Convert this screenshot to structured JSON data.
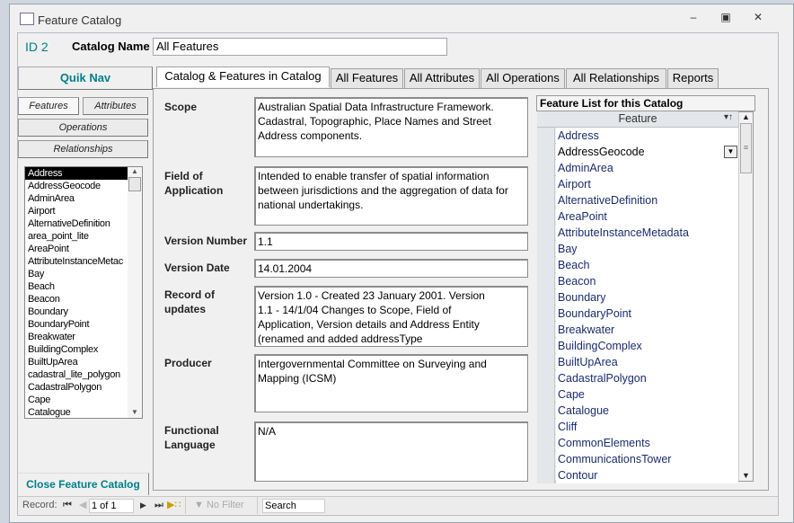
{
  "window": {
    "title": "Feature Catalog",
    "controls": [
      "minimize",
      "restore",
      "close"
    ]
  },
  "header": {
    "id_label": "ID",
    "id_value": "2",
    "catalog_name_label": "Catalog Name",
    "catalog_name_value": "All Features"
  },
  "quik_nav": {
    "label": "Quik Nav",
    "buttons": [
      "Features",
      "Attributes",
      "Operations",
      "Relationships"
    ]
  },
  "left_list": {
    "items": [
      "Address",
      "AddressGeocode",
      "AdminArea",
      "Airport",
      "AlternativeDefinition",
      "area_point_lite",
      "AreaPoint",
      "AttributeInstanceMetac",
      "Bay",
      "Beach",
      "Beacon",
      "Boundary",
      "BoundaryPoint",
      "Breakwater",
      "BuildingComplex",
      "BuiltUpArea",
      "cadastral_lite_polygon",
      "CadastralPolygon",
      "Cape",
      "Catalogue"
    ],
    "selected": "Address"
  },
  "tabs": [
    "Catalog & Features in Catalog",
    "All Features",
    "All Attributes",
    "All Operations",
    "All Relationships",
    "Reports"
  ],
  "fields": {
    "scope": {
      "label": "Scope",
      "value": "Australian Spatial Data Infrastructure Framework. Cadastral, Topographic, Place Names and Street Address components."
    },
    "field_of_application": {
      "label": "Field of Application",
      "value": "Intended to enable transfer of spatial information between jurisdictions and the aggregation of data for national undertakings."
    },
    "version_number": {
      "label": "Version Number",
      "value": "1.1"
    },
    "version_date": {
      "label": "Version Date",
      "value": "14.01.2004"
    },
    "record_of_updates": {
      "label": "Record of updates",
      "value": "Version 1.0 - Created 23 January 2001. Version 1.1 - 14/1/04 Changes to Scope, Field of Application, Version details and Address Entity (renamed and added addressType"
    },
    "producer": {
      "label": "Producer",
      "value": "Intergovernmental Committee on Surveying and Mapping (ICSM)"
    },
    "functional_language": {
      "label": "Functional Language",
      "value": "N/A"
    }
  },
  "feature_list": {
    "title": "Feature List for this Catalog",
    "column": "Feature",
    "rows": [
      "Address",
      "AddressGeocode",
      "AdminArea",
      "Airport",
      "AlternativeDefinition",
      "AreaPoint",
      "AttributeInstanceMetadata",
      "Bay",
      "Beach",
      "Beacon",
      "Boundary",
      "BoundaryPoint",
      "Breakwater",
      "BuildingComplex",
      "BuiltUpArea",
      "CadastralPolygon",
      "Cape",
      "Catalogue",
      "Cliff",
      "CommonElements",
      "CommunicationsTower",
      "Contour"
    ],
    "active_row": "AddressGeocode"
  },
  "close_button": "Close Feature Catalog",
  "record_nav": {
    "label": "Record:",
    "position": "1 of 1",
    "filter": "No Filter",
    "search_placeholder": "Search"
  },
  "colors": {
    "accent": "#00808b"
  }
}
